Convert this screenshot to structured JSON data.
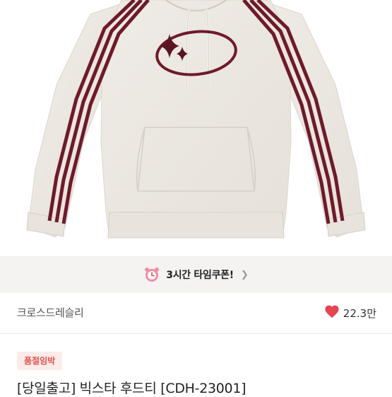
{
  "product": {
    "image_alt": "hoodie-product-photo",
    "coupon_text": "3시간 타임쿠폰!",
    "store_name": "크로스드레슬리",
    "like_count": "22.3만",
    "badge": "품절임박",
    "title": "[당일출고] 빅스타 후드티 [CDH-23001]"
  },
  "colors": {
    "accent_red": "#e2524c",
    "heart": "#e8434f",
    "stripe": "#6e1a2a"
  }
}
